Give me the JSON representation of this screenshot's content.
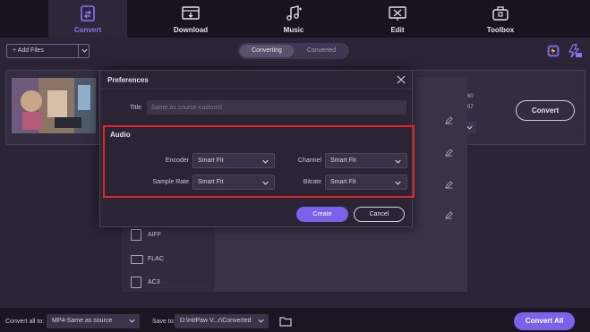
{
  "nav": {
    "items": [
      {
        "label": "Convert",
        "icon": "convert-icon",
        "active": true
      },
      {
        "label": "Download",
        "icon": "download-icon"
      },
      {
        "label": "Music",
        "icon": "music-icon"
      },
      {
        "label": "Edit",
        "icon": "edit-icon"
      },
      {
        "label": "Toolbox",
        "icon": "toolbox-icon"
      }
    ]
  },
  "toolbar": {
    "add_files": "+ Add Files",
    "tabs": [
      "Converting",
      "Converted"
    ],
    "icons": [
      "hardware-accel-icon",
      "speed-4k-icon"
    ]
  },
  "background": {
    "values": [
      "60",
      "07"
    ]
  },
  "file": {
    "convert_label": "Convert"
  },
  "formats": [
    {
      "label": "AIFF"
    },
    {
      "label": "FLAC"
    },
    {
      "label": "AC3"
    }
  ],
  "modal": {
    "title": "Preferences",
    "title_label": "Title",
    "title_placeholder": "Same as source-custom0",
    "audio": {
      "heading": "Audio",
      "encoder_label": "Encoder",
      "encoder_value": "Smart Fit",
      "channel_label": "Channel",
      "channel_value": "Smart Fit",
      "sample_rate_label": "Sample Rate",
      "sample_rate_value": "Smart Fit",
      "bitrate_label": "Bitrate",
      "bitrate_value": "Smart Fit"
    },
    "create_label": "Create",
    "cancel_label": "Cancel"
  },
  "bottom": {
    "convert_all_to_label": "Convert all to:",
    "convert_all_to_value": "MP4-Same as source",
    "save_to_label": "Save to:",
    "save_to_value": "D:\\HitPaw V...r\\Converted",
    "convert_all_label": "Convert All"
  },
  "colors": {
    "accent": "#7a63ea",
    "highlight_border": "#e0262b",
    "nav_bg": "#17131f",
    "page_bg": "#2b2436"
  }
}
